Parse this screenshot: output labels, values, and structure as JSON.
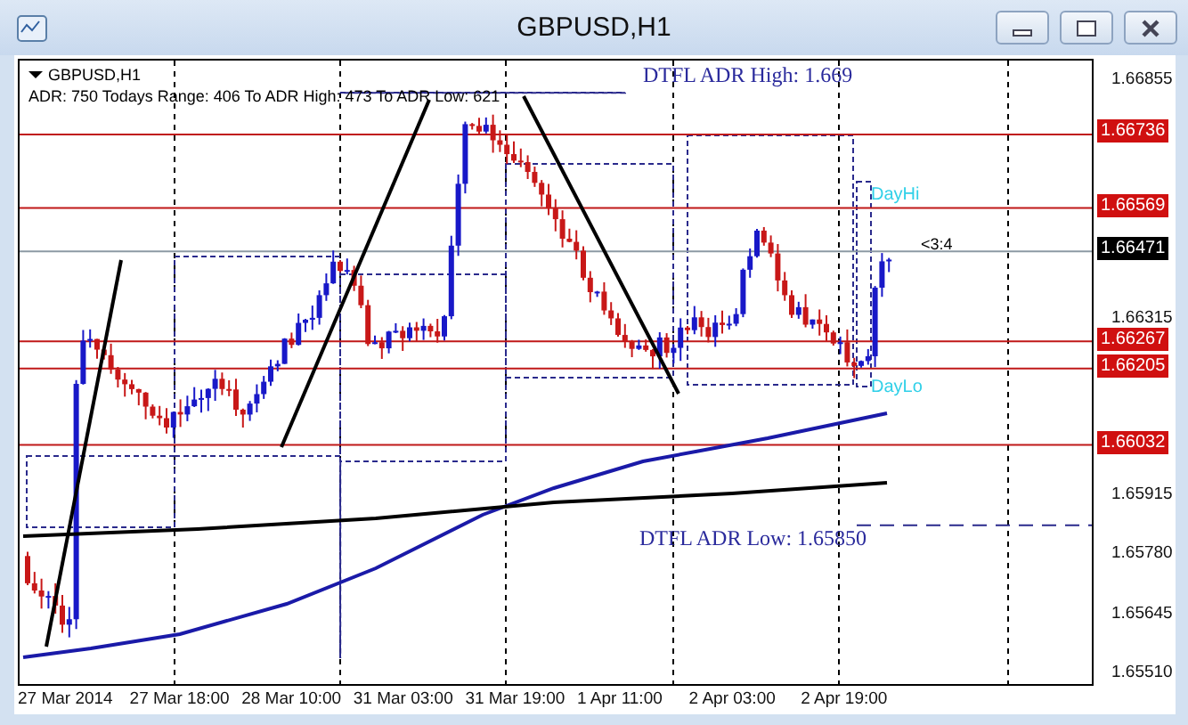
{
  "window": {
    "title": "GBPUSD,H1"
  },
  "chart": {
    "symbol": "GBPUSD,H1",
    "info": "ADR: 750  Todays Range: 406  To ADR High: 473  To ADR Low: 621",
    "adr_high_label": "DTFL ADR High: 1.669",
    "adr_low_label": "DTFL ADR Low: 1.65850",
    "day_high_label": "DayHi",
    "day_low_label": "DayLo",
    "countdown": "<3:4",
    "price_axis": [
      "1.66855",
      "1.66315",
      "1.65915",
      "1.65780",
      "1.65645",
      "1.65510"
    ],
    "levels": [
      {
        "price": "1.66736",
        "kind": "level"
      },
      {
        "price": "1.66569",
        "kind": "level"
      },
      {
        "price": "1.66471",
        "kind": "current"
      },
      {
        "price": "1.66267",
        "kind": "level"
      },
      {
        "price": "1.66205",
        "kind": "level"
      },
      {
        "price": "1.66032",
        "kind": "level"
      }
    ],
    "time_axis": [
      "27 Mar 2014",
      "27 Mar 18:00",
      "28 Mar 10:00",
      "31 Mar 03:00",
      "31 Mar 19:00",
      "1 Apr 11:00",
      "2 Apr 03:00",
      "2 Apr 19:00"
    ]
  }
}
